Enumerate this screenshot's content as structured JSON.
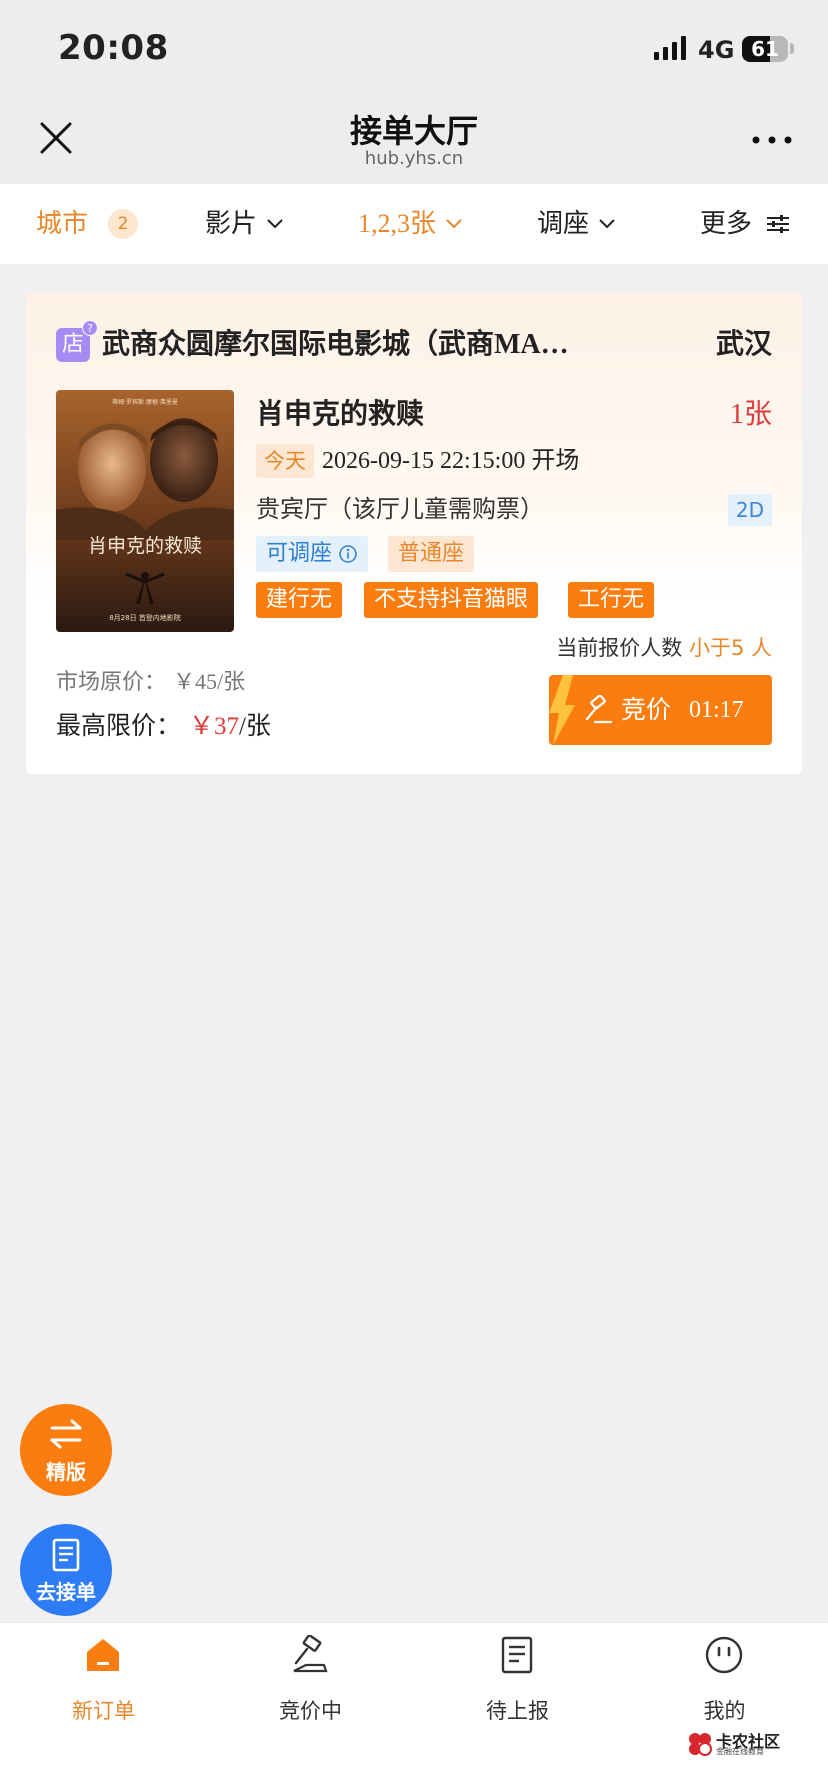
{
  "status": {
    "time": "20:08",
    "network": "4G",
    "battery": "61",
    "battery_level": 0.61
  },
  "nav": {
    "title": "接单大厅",
    "url": "hub.yhs.cn",
    "close_icon": "close-icon",
    "more_icon": "more-icon"
  },
  "filters": [
    {
      "label": "城市",
      "badge": "2",
      "active": true
    },
    {
      "label": "影片",
      "active": false
    },
    {
      "label": "1,2,3张",
      "active": true
    },
    {
      "label": "调座",
      "active": false
    },
    {
      "label": "更多",
      "active": false
    }
  ],
  "order": {
    "shop_icon": "店",
    "shop_question": "?",
    "cinema": "武商众圆摩尔国际电影城（武商MA…",
    "city": "武汉",
    "movie_title": "肖申克的救赎",
    "ticket_count": "1张",
    "day_tag": "今天",
    "showtime": "2026-09-15 22:15:00 开场",
    "hall": "贵宾厅（该厅儿童需购票）",
    "format": "2D",
    "tag_adjustable": "可调座",
    "tag_seat_type": "普通座",
    "tags": [
      "建行无",
      "不支持抖音猫眼",
      "工行无"
    ],
    "quote_prefix": "当前报价人数",
    "quote_value": "小于5 人",
    "market_price_label": "市场原价：",
    "market_price": "￥45/张",
    "max_price_label": "最高限价：",
    "max_price_value": "￥37",
    "max_price_unit": "/张",
    "bid_label": "竞价",
    "bid_timer": "01:17",
    "poster": {
      "top_names": "蒂姆·罗宾斯   摩根·弗里曼",
      "title": "肖申克的救赎",
      "release": "8月28日 首登内地影院"
    }
  },
  "fabs": [
    {
      "label": "精版",
      "icon": "swap-icon",
      "color": "#fb7d0f"
    },
    {
      "label": "去接单",
      "icon": "document-icon",
      "color": "#2d7cf6"
    }
  ],
  "tabs": [
    {
      "label": "新订单",
      "icon": "home-icon",
      "active": true
    },
    {
      "label": "竞价中",
      "icon": "gavel-icon",
      "active": false
    },
    {
      "label": "待上报",
      "icon": "report-icon",
      "active": false
    },
    {
      "label": "我的",
      "icon": "profile-icon",
      "active": false
    }
  ],
  "watermark": {
    "text": "卡农社区",
    "sub": "金融在线教育"
  },
  "colors": {
    "accent": "#fb7d0f",
    "accent_text": "#e8872a",
    "price_red": "#e0393a",
    "blue": "#2d7cf6"
  }
}
